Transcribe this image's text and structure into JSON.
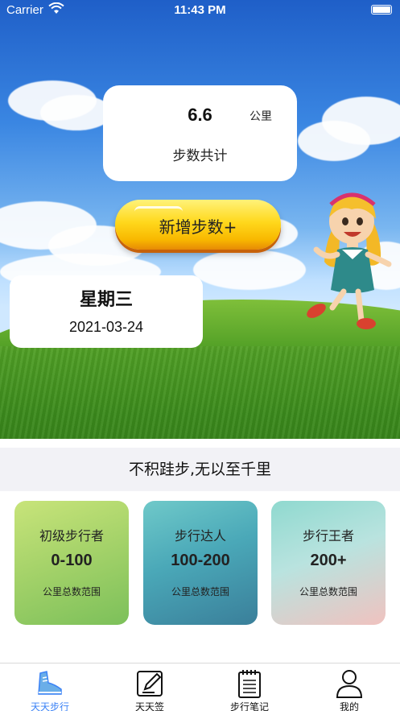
{
  "status_bar": {
    "carrier": "Carrier",
    "time": "11:43 PM"
  },
  "stats": {
    "value": "6.6",
    "unit": "公里",
    "label": "步数共计"
  },
  "add_button": {
    "label": "新增步数+"
  },
  "date_card": {
    "weekday": "星期三",
    "date": "2021-03-24"
  },
  "motto": "不积跬步,无以至千里",
  "levels": [
    {
      "title": "初级步行者",
      "range": "0-100",
      "note": "公里总数范围"
    },
    {
      "title": "步行达人",
      "range": "100-200",
      "note": "公里总数范围"
    },
    {
      "title": "步行王者",
      "range": "200+",
      "note": "公里总数范围"
    }
  ],
  "tabs": [
    {
      "label": "天天步行",
      "icon": "sneaker-icon",
      "active": true
    },
    {
      "label": "天天签",
      "icon": "edit-icon",
      "active": false
    },
    {
      "label": "步行笔记",
      "icon": "notebook-icon",
      "active": false
    },
    {
      "label": "我的",
      "icon": "person-icon",
      "active": false
    }
  ],
  "colors": {
    "active_tab": "#3b82f6",
    "button_yellow": "#ffd81c"
  }
}
